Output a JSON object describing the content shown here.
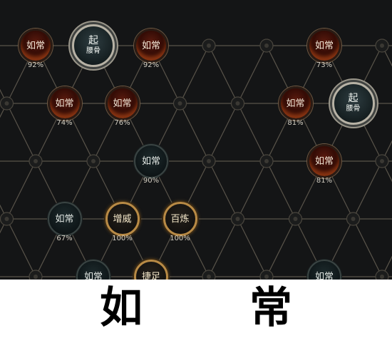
{
  "board": {
    "nodes": [
      {
        "id": "n1",
        "style": "red",
        "name": "如常",
        "pct": "92%"
      },
      {
        "id": "n2",
        "style": "start",
        "name": "起",
        "sub": "腰骨"
      },
      {
        "id": "n3",
        "style": "red",
        "name": "如常",
        "pct": "92%"
      },
      {
        "id": "n4",
        "style": "red",
        "name": "如常",
        "pct": "73%"
      },
      {
        "id": "n5",
        "style": "red",
        "name": "如常",
        "pct": "74%"
      },
      {
        "id": "n6",
        "style": "red",
        "name": "如常",
        "pct": "76%"
      },
      {
        "id": "n7",
        "style": "red",
        "name": "如常",
        "pct": "81%"
      },
      {
        "id": "n8",
        "style": "start",
        "name": "起",
        "sub": "腰骨"
      },
      {
        "id": "n9",
        "style": "dark",
        "name": "如常",
        "pct": "90%"
      },
      {
        "id": "n10",
        "style": "red",
        "name": "如常",
        "pct": "81%"
      },
      {
        "id": "n11",
        "style": "dark",
        "name": "如常",
        "pct": "67%"
      },
      {
        "id": "n12",
        "style": "gold",
        "name": "增威",
        "pct": "100%"
      },
      {
        "id": "n13",
        "style": "gold",
        "name": "百炼",
        "pct": "100%"
      },
      {
        "id": "n14",
        "style": "dark",
        "name": "如常"
      },
      {
        "id": "n15",
        "style": "gold",
        "name": "捷足"
      },
      {
        "id": "n16",
        "style": "dark",
        "name": "如常"
      }
    ]
  },
  "caption": {
    "left": "如",
    "right": "常"
  },
  "colors": {
    "background": "#141516",
    "line": "#59544a",
    "red_node": "#5a1a0e",
    "gold_ring": "#b88a45",
    "caption_bg": "#ffffff",
    "caption_text": "#000000"
  }
}
